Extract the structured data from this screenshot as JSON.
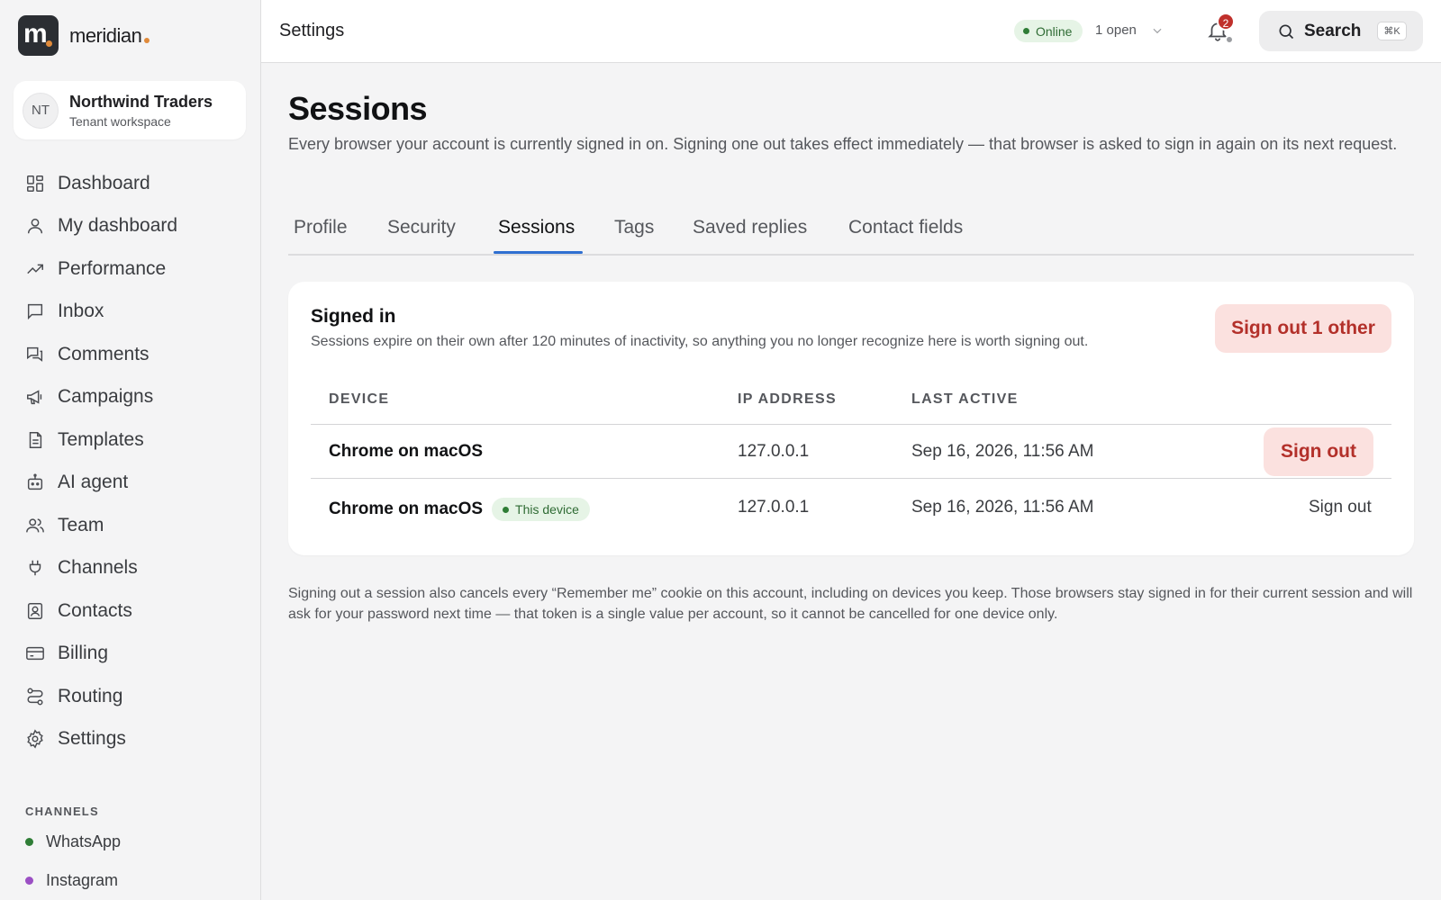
{
  "brand": {
    "name": "meridian",
    "mark_letter": "m",
    "accent": "#e08a3a"
  },
  "workspace": {
    "initials": "NT",
    "name": "Northwind Traders",
    "subtitle": "Tenant workspace"
  },
  "sidebar": {
    "items": [
      {
        "label": "Dashboard",
        "icon": "grid-icon"
      },
      {
        "label": "My dashboard",
        "icon": "user-icon"
      },
      {
        "label": "Performance",
        "icon": "trend-icon"
      },
      {
        "label": "Inbox",
        "icon": "message-icon"
      },
      {
        "label": "Comments",
        "icon": "comments-icon"
      },
      {
        "label": "Campaigns",
        "icon": "megaphone-icon"
      },
      {
        "label": "Templates",
        "icon": "document-icon"
      },
      {
        "label": "AI agent",
        "icon": "robot-icon"
      },
      {
        "label": "Team",
        "icon": "users-icon"
      },
      {
        "label": "Channels",
        "icon": "plug-icon"
      },
      {
        "label": "Contacts",
        "icon": "contact-card-icon"
      },
      {
        "label": "Billing",
        "icon": "credit-card-icon"
      },
      {
        "label": "Routing",
        "icon": "route-icon"
      },
      {
        "label": "Settings",
        "icon": "gear-icon"
      }
    ],
    "channels_label": "CHANNELS",
    "channels": [
      {
        "label": "WhatsApp",
        "color": "#2f7d36"
      },
      {
        "label": "Instagram",
        "color": "#9b4fc4"
      }
    ]
  },
  "topbar": {
    "title": "Settings",
    "status": "Online",
    "open_count": "1 open",
    "notifications": "2",
    "search_label": "Search",
    "search_shortcut": "⌘K"
  },
  "page": {
    "title": "Sessions",
    "description": "Every browser your account is currently signed in on. Signing one out takes effect immediately — that browser is asked to sign in again on its next request."
  },
  "tabs": [
    {
      "label": "Profile",
      "active": false
    },
    {
      "label": "Security",
      "active": false
    },
    {
      "label": "Sessions",
      "active": true
    },
    {
      "label": "Tags",
      "active": false
    },
    {
      "label": "Saved replies",
      "active": false
    },
    {
      "label": "Contact fields",
      "active": false
    }
  ],
  "sessions": {
    "title": "Signed in",
    "subtitle": "Sessions expire on their own after 120 minutes of inactivity, so anything you no longer recognize here is worth signing out.",
    "sign_out_others": "Sign out 1 other",
    "columns": [
      "DEVICE",
      "IP ADDRESS",
      "LAST ACTIVE"
    ],
    "rows": [
      {
        "device": "Chrome on macOS",
        "ip": "127.0.0.1",
        "last_active": "Sep 16, 2026, 11:56 AM",
        "badge": "",
        "action": "Sign out"
      },
      {
        "device": "Chrome on macOS",
        "ip": "127.0.0.1",
        "last_active": "Sep 16, 2026, 11:56 AM",
        "badge": "This device",
        "action": "Sign out"
      }
    ]
  },
  "footnote": "Signing out a session also cancels every “Remember me” cookie on this account, including on devices you keep. Those browsers stay signed in for their current session and will ask for your password next time — that token is a single value per account, so it cannot be cancelled for one device only."
}
